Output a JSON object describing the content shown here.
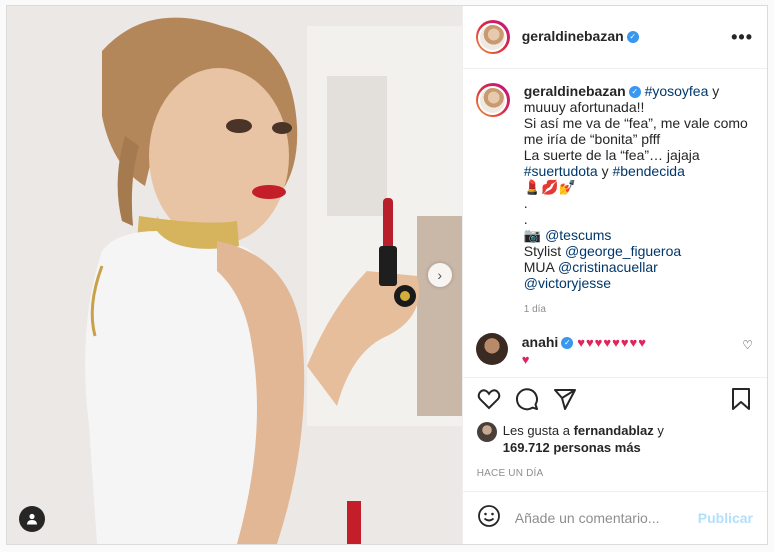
{
  "header": {
    "username": "geraldinebazan",
    "more_label": "•••"
  },
  "caption": {
    "username": "geraldinebazan",
    "hashtag1": "#yosoyfea",
    "line1_tail": " y",
    "line2": "muuuy afortunada!!",
    "line3": "Si así me va de “fea”, me vale como",
    "line4": "me iría de “bonita” pfff",
    "line5": "La suerte de la “fea”… jajaja",
    "hashtag2": "#suertudota",
    "and": " y ",
    "hashtag3": "#bendecida",
    "emojis": "💄💋💅",
    "dot1": ".",
    "dot2": ".",
    "camera": "📷",
    "mention1": "@tescums",
    "stylist_label": "Stylist ",
    "mention2": "@george_figueroa",
    "mua_label": "MUA ",
    "mention3": "@cristinacuellar",
    "mention4": "@victoryjesse",
    "time": "1 día"
  },
  "comment": {
    "username": "anahi",
    "hearts_line1": "♥♥♥♥♥♥♥♥",
    "hearts_line2": "♥",
    "like_icon": "heart-outline"
  },
  "likes": {
    "prefix": "Les gusta a ",
    "user": "fernandablaz",
    "suffix": " y",
    "count": "169.712 personas más"
  },
  "posted_ago": "HACE UN DÍA",
  "add_comment": {
    "placeholder": "Añade un comentario...",
    "publish": "Publicar"
  },
  "colors": {
    "link": "#00376b",
    "verified": "#3897f0",
    "heart": "#e0245e",
    "publish": "#b2dffc"
  }
}
